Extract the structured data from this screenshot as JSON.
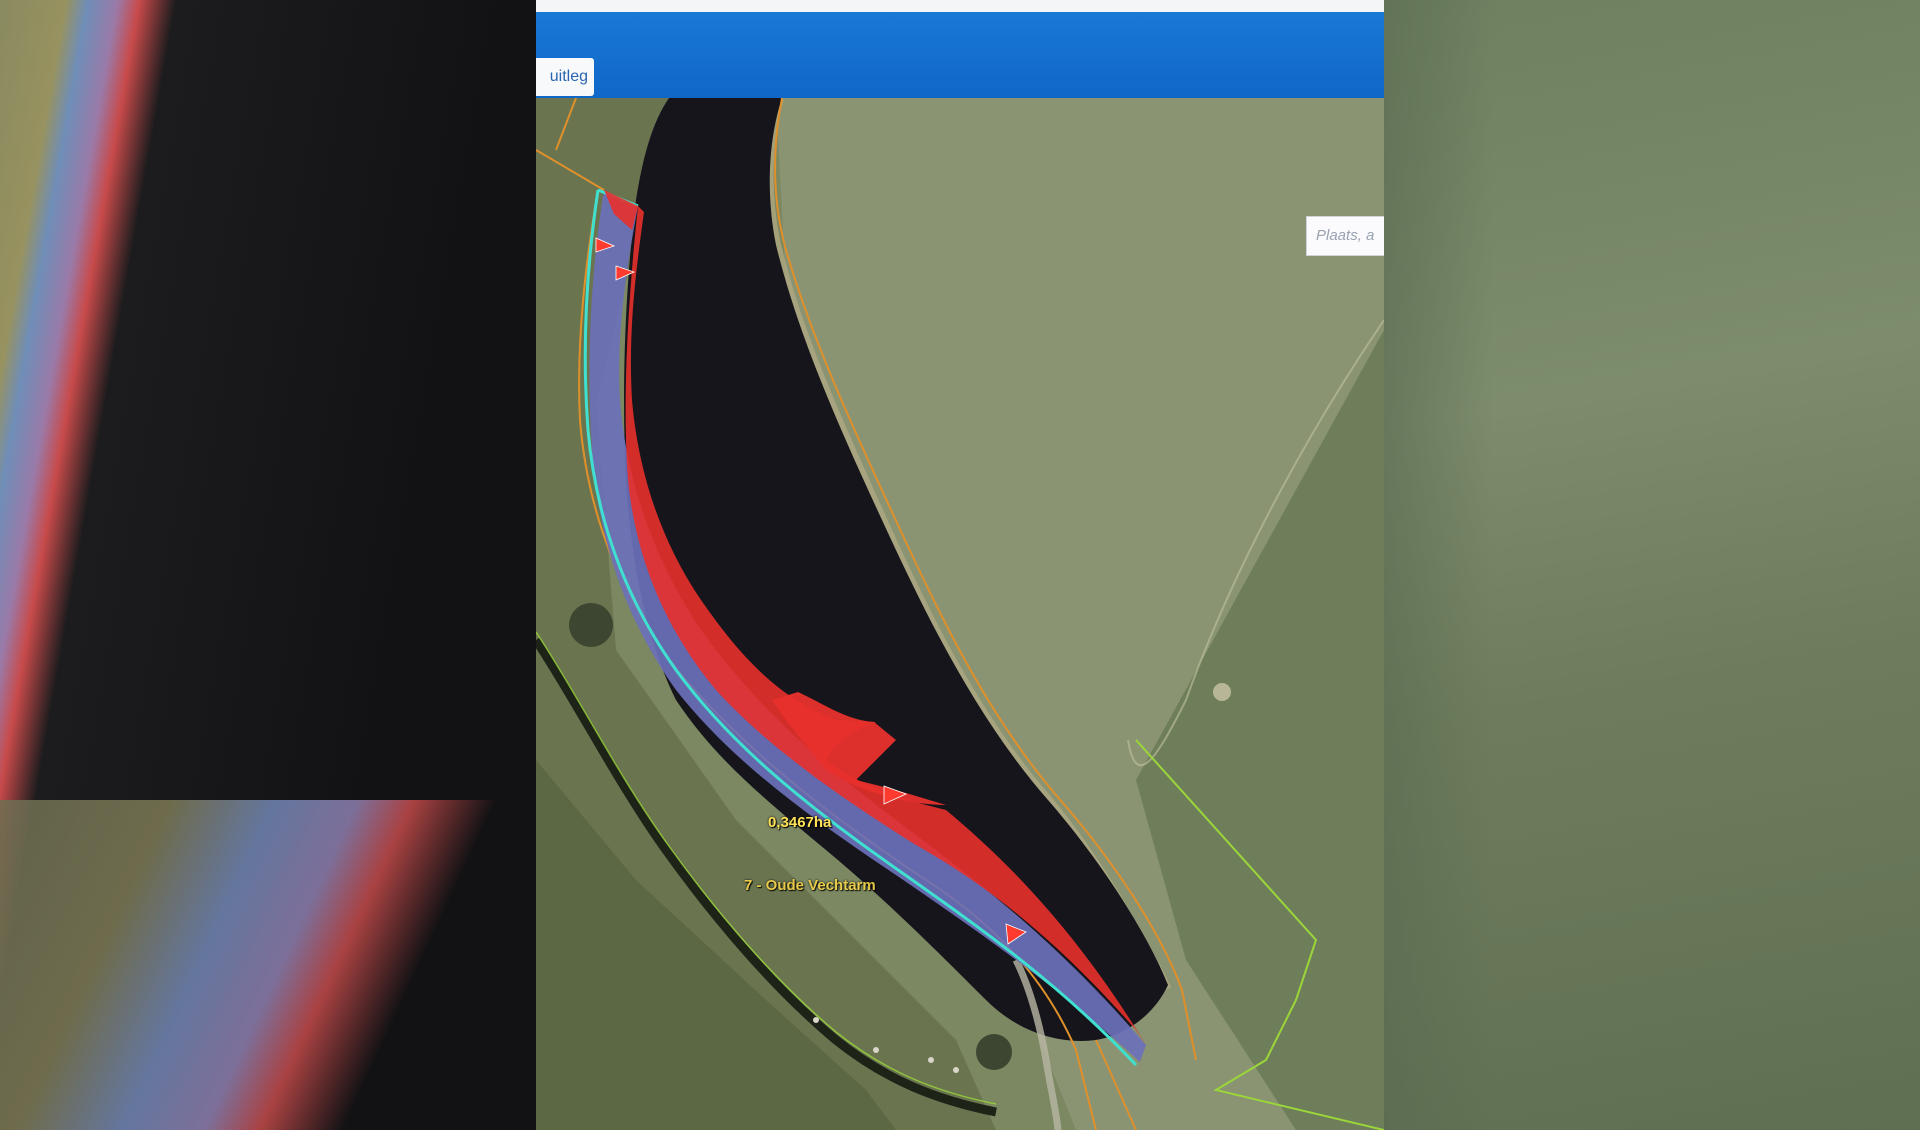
{
  "header": {
    "tab_label": "uitleg"
  },
  "search": {
    "placeholder": "Plaats, a"
  },
  "map": {
    "area_label": "0,3467ha",
    "parcel_label": "7 - Oude Vechtarm"
  },
  "colors": {
    "header_blue": "#1067c7",
    "water": "#14141a",
    "meadow": "#7d8a66",
    "parcel_fill": "#6a6fb8",
    "parcel_outline": "#40e0d0",
    "change_fill": "#e8302c",
    "cadastral_line": "#e0902a",
    "boundary_line": "#9ad63a"
  },
  "icons": [
    "red-flag-marker-icon"
  ]
}
